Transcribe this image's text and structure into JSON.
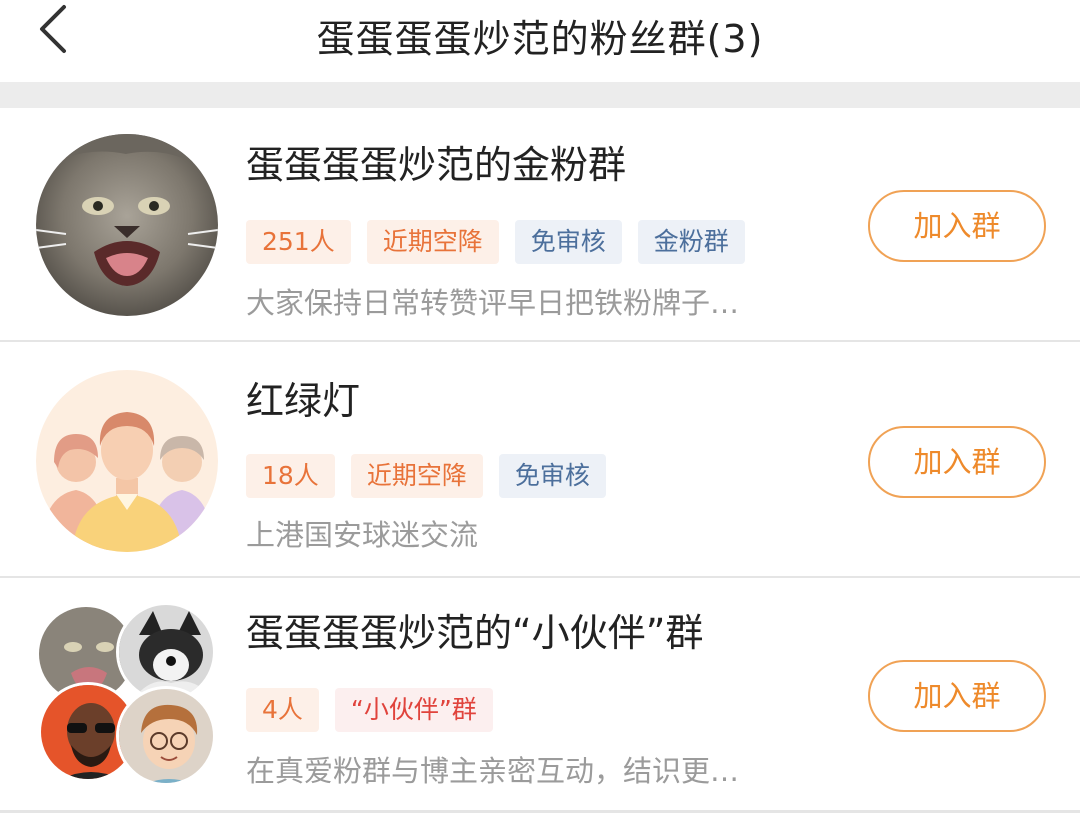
{
  "header": {
    "title": "蛋蛋蛋蛋炒范的粉丝群(3)",
    "back_icon": "chevron-left-icon"
  },
  "groups": [
    {
      "name": "蛋蛋蛋蛋炒范的金粉群",
      "avatar": "wildcat-photo",
      "tags": [
        {
          "text": "251人",
          "tone": "orange"
        },
        {
          "text": "近期空降",
          "tone": "orange"
        },
        {
          "text": "免审核",
          "tone": "blue"
        },
        {
          "text": "金粉群",
          "tone": "blue"
        }
      ],
      "description": "大家保持日常转赞评早日把铁粉牌子…",
      "join_label": "加入群"
    },
    {
      "name": "红绿灯",
      "avatar": "default-group-people",
      "tags": [
        {
          "text": "18人",
          "tone": "orange"
        },
        {
          "text": "近期空降",
          "tone": "orange"
        },
        {
          "text": "免审核",
          "tone": "blue"
        }
      ],
      "description": "上港国安球迷交流",
      "join_label": "加入群"
    },
    {
      "name": "蛋蛋蛋蛋炒范的“小伙伴”群",
      "avatar": "member-avatar-cluster",
      "tags": [
        {
          "text": "4人",
          "tone": "orange"
        },
        {
          "text": "“小伙伴”群",
          "tone": "red"
        }
      ],
      "description": "在真爱粉群与博主亲密互动，结识更…",
      "join_label": "加入群"
    }
  ],
  "colors": {
    "accent": "#ee8a2b",
    "tag_orange_bg": "#fdf0e8",
    "tag_blue_bg": "#edf1f7",
    "tag_red_text": "#e0433c",
    "separator_band": "#ececec"
  }
}
